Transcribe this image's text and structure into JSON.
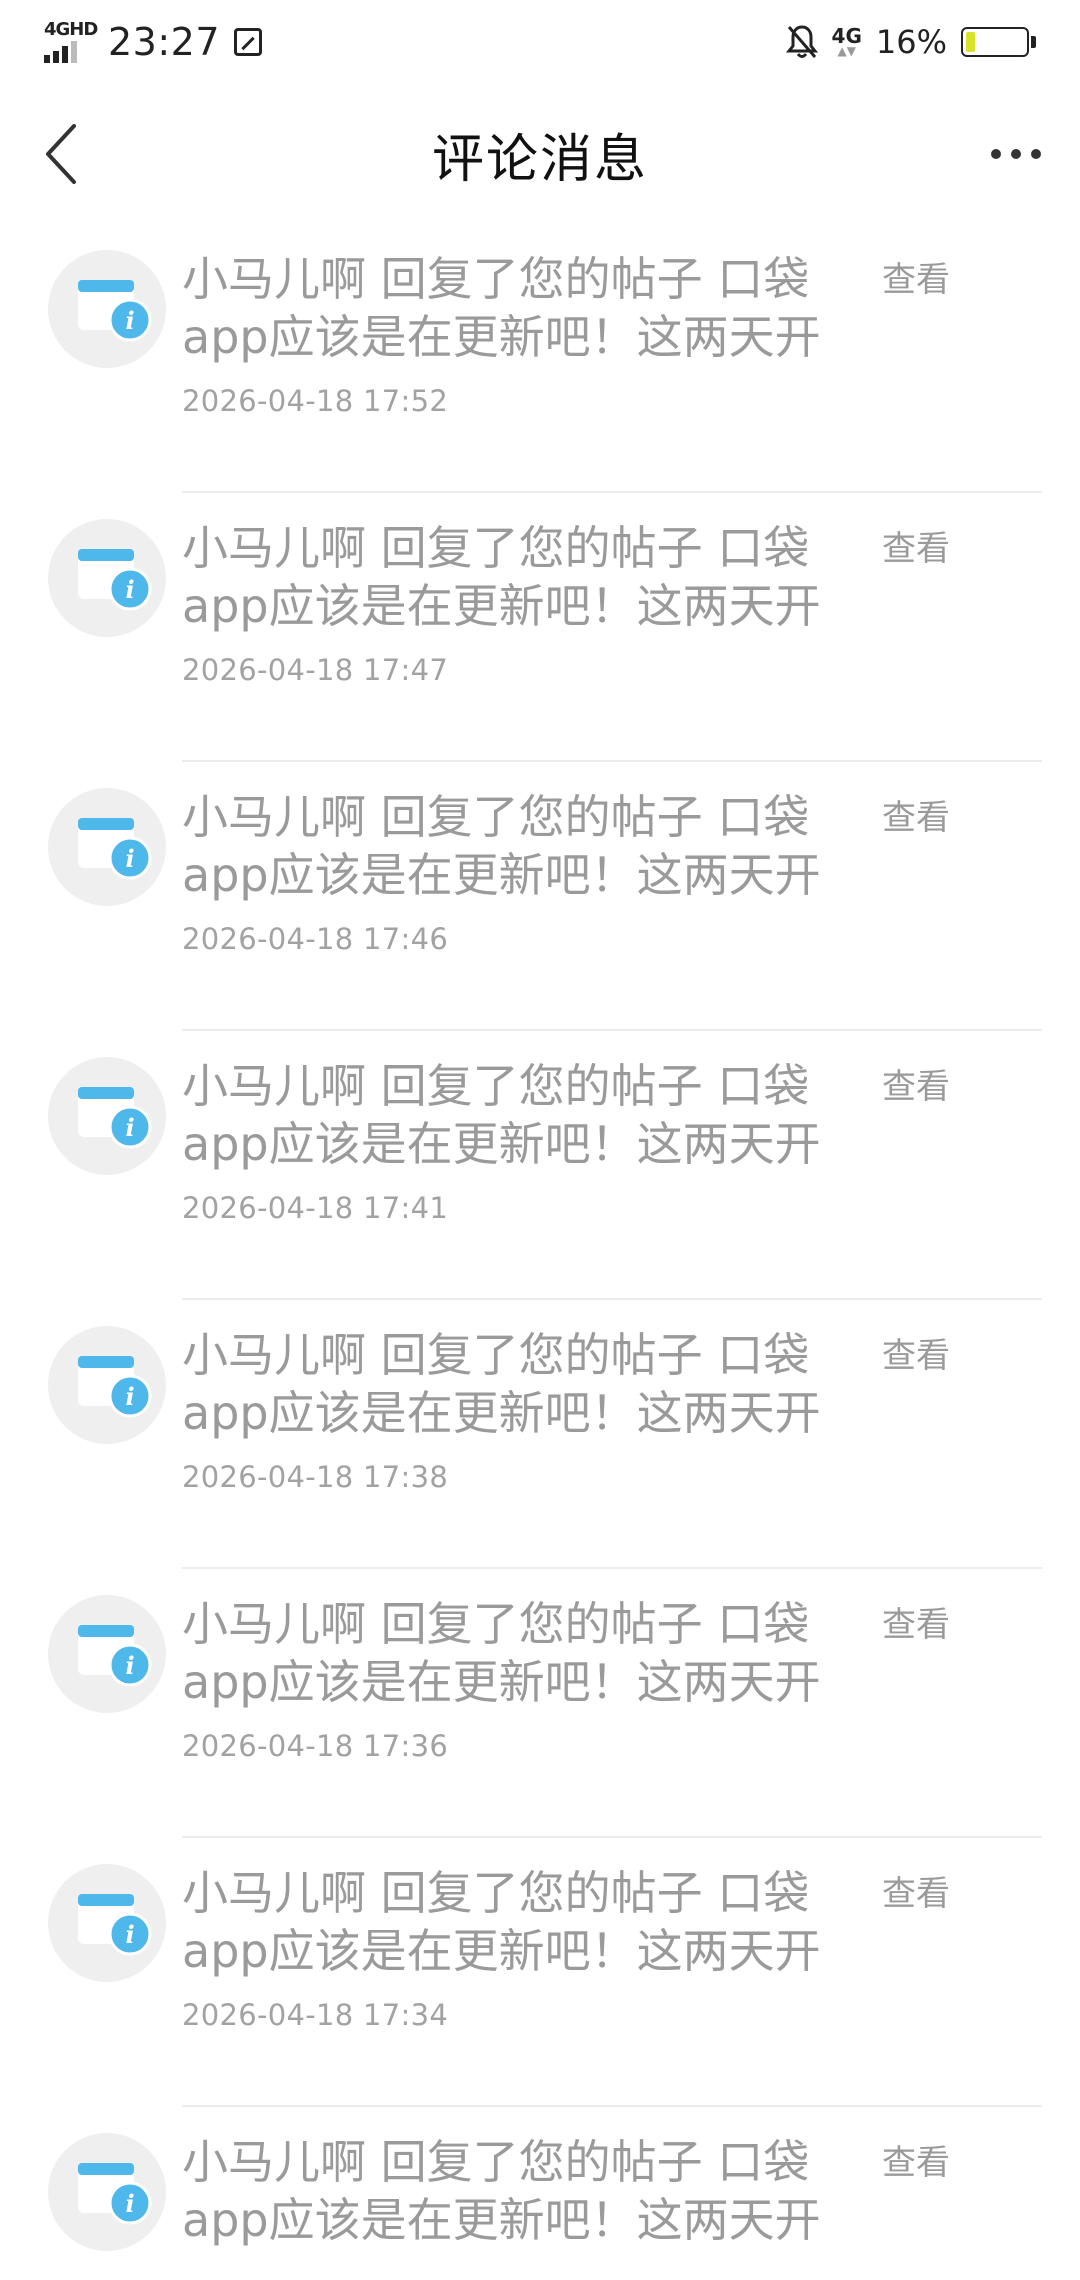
{
  "status_bar": {
    "network_type": "4GHD",
    "time": "23:27",
    "mobile_data": "4G",
    "battery_percent": "16%",
    "battery_level": 0.16,
    "battery_fill_color": "#d9e22a"
  },
  "nav": {
    "title": "评论消息",
    "back_icon": "chevron-left-icon",
    "more_icon": "more-horizontal-icon"
  },
  "colors": {
    "avatar_bg": "#efefef",
    "icon_blue": "#4fb8ea",
    "text_gray": "#9a9a9a"
  },
  "messages": [
    {
      "line1": "小马儿啊 回复了您的帖子 口袋",
      "line2": "app应该是在更新吧！这两天开",
      "time": "2026-04-18 17:52",
      "action": "查看"
    },
    {
      "line1": "小马儿啊 回复了您的帖子 口袋",
      "line2": "app应该是在更新吧！这两天开",
      "time": "2026-04-18 17:47",
      "action": "查看"
    },
    {
      "line1": "小马儿啊 回复了您的帖子 口袋",
      "line2": "app应该是在更新吧！这两天开",
      "time": "2026-04-18 17:46",
      "action": "查看"
    },
    {
      "line1": "小马儿啊 回复了您的帖子 口袋",
      "line2": "app应该是在更新吧！这两天开",
      "time": "2026-04-18 17:41",
      "action": "查看"
    },
    {
      "line1": "小马儿啊 回复了您的帖子 口袋",
      "line2": "app应该是在更新吧！这两天开",
      "time": "2026-04-18 17:38",
      "action": "查看"
    },
    {
      "line1": "小马儿啊 回复了您的帖子 口袋",
      "line2": "app应该是在更新吧！这两天开",
      "time": "2026-04-18 17:36",
      "action": "查看"
    },
    {
      "line1": "小马儿啊 回复了您的帖子 口袋",
      "line2": "app应该是在更新吧！这两天开",
      "time": "2026-04-18 17:34",
      "action": "查看"
    },
    {
      "line1": "小马儿啊 回复了您的帖子 口袋",
      "line2": "app应该是在更新吧！这两天开",
      "time": "",
      "action": "查看"
    }
  ]
}
